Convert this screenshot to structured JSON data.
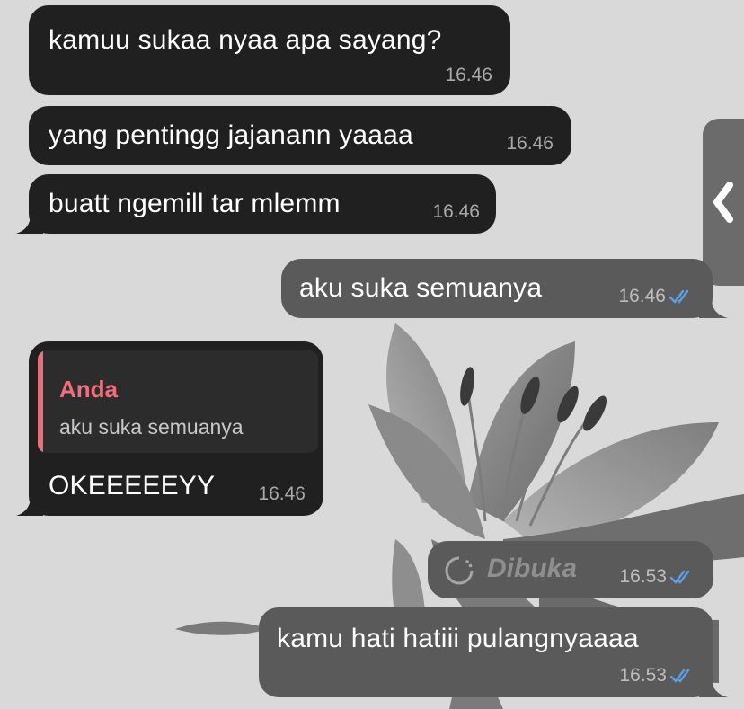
{
  "messages": [
    {
      "text": "kamuu sukaa nyaa apa sayang?",
      "time": "16.46"
    },
    {
      "text": "yang pentingg jajanann yaaaa",
      "time": "16.46"
    },
    {
      "text": "buatt ngemill tar mlemm",
      "time": "16.46"
    },
    {
      "text": "aku suka semuanya",
      "time": "16.46"
    },
    {
      "reply_name": "Anda",
      "reply_text": "aku suka semuanya",
      "text": "OKEEEEEYY",
      "time": "16.46"
    },
    {
      "text": "Dibuka",
      "time": "16.53"
    },
    {
      "text": "kamu hati hatiii pulangnyaaaa",
      "time": "16.53"
    }
  ],
  "colors": {
    "incoming_bubble": "#202020",
    "outgoing_bubble": "#5a5a5a",
    "read_ticks": "#5aa0e6",
    "reply_accent": "#e8707a"
  },
  "icons": {
    "read_status": "double-check-icon",
    "view_once": "view-once-icon",
    "side_panel": "chevron-left-icon"
  }
}
